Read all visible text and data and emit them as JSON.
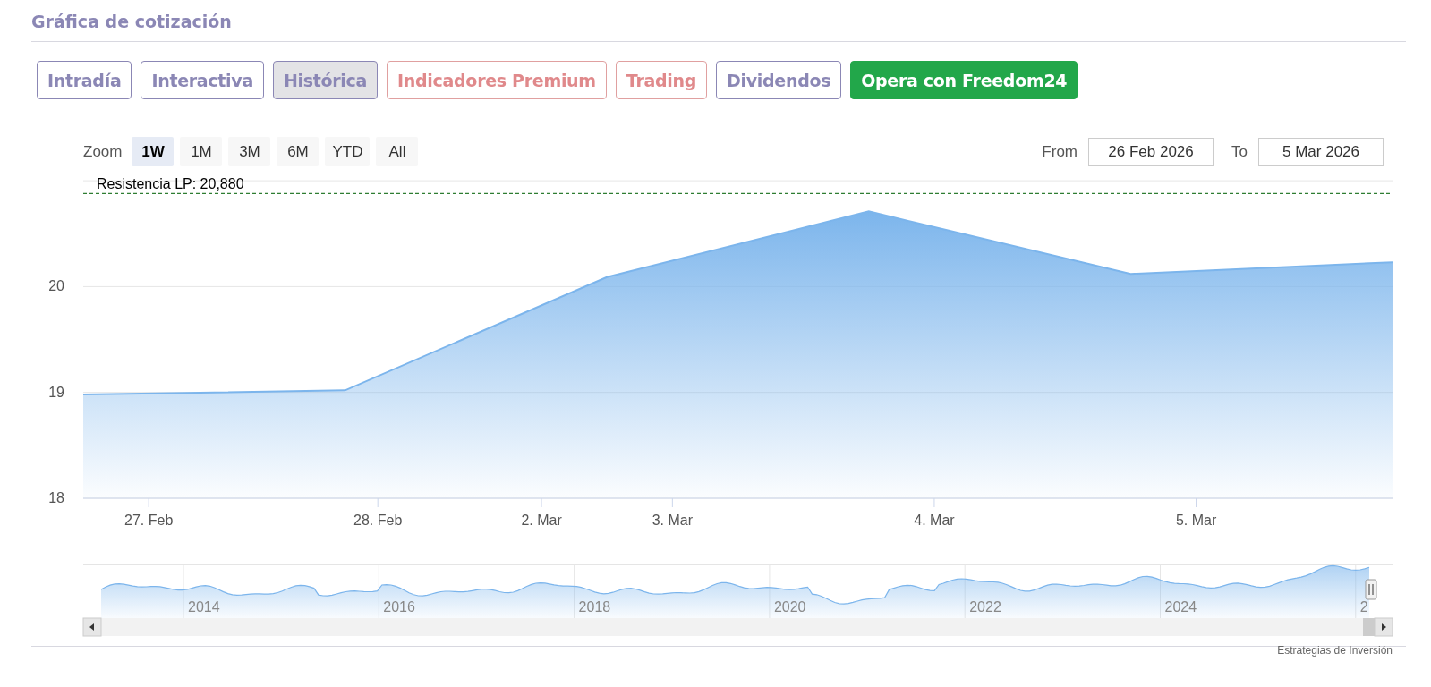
{
  "section": {
    "title": "Gráfica de cotización"
  },
  "tabs": [
    {
      "label": "Intradía",
      "kind": "standard",
      "selected": false
    },
    {
      "label": "Interactiva",
      "kind": "standard",
      "selected": false
    },
    {
      "label": "Histórica",
      "kind": "standard",
      "selected": true
    },
    {
      "label": "Indicadores Premium",
      "kind": "premium",
      "selected": false
    },
    {
      "label": "Trading",
      "kind": "premium",
      "selected": false
    },
    {
      "label": "Dividendos",
      "kind": "standard",
      "selected": false
    },
    {
      "label": "Opera con Freedom24",
      "kind": "cta",
      "selected": false
    }
  ],
  "range_selector": {
    "label": "Zoom",
    "buttons": [
      {
        "label": "1W",
        "selected": true
      },
      {
        "label": "1M",
        "selected": false
      },
      {
        "label": "3M",
        "selected": false
      },
      {
        "label": "6M",
        "selected": false
      },
      {
        "label": "YTD",
        "selected": false
      },
      {
        "label": "All",
        "selected": false
      }
    ],
    "from_label": "From",
    "from_value": "26 Feb 2026",
    "to_label": "To",
    "to_value": "5 Mar 2026"
  },
  "chart": {
    "chart_data": {
      "type": "area",
      "categories": [
        null,
        null,
        "27. Feb",
        null,
        null,
        null,
        null,
        null,
        null,
        "28. Feb",
        null,
        null,
        null,
        null,
        "2. Mar",
        null,
        null,
        null,
        "3. Mar",
        null,
        null,
        null,
        null,
        null,
        null,
        null,
        "4. Mar",
        null,
        null,
        null,
        null,
        null,
        null,
        null,
        "5. Mar",
        null,
        null,
        null,
        null,
        null,
        null
      ],
      "series": [
        {
          "color": "#7cb5ec",
          "values": [
            18.98,
            null,
            null,
            null,
            null,
            null,
            null,
            null,
            19.02,
            null,
            null,
            null,
            null,
            null,
            null,
            null,
            20.09,
            null,
            null,
            null,
            null,
            null,
            null,
            null,
            20.71,
            null,
            null,
            null,
            null,
            null,
            null,
            null,
            20.12,
            null,
            null,
            null,
            null,
            null,
            null,
            null,
            20.23
          ]
        }
      ],
      "ylim": [
        18,
        21
      ],
      "yticks": [
        18,
        19,
        20
      ],
      "ref_lines": [
        {
          "axis": "y",
          "value": 20.88,
          "label": "Resistencia LP: 20,880"
        }
      ]
    }
  },
  "navigator": {
    "year_labels": [
      "2014",
      "2016",
      "2018",
      "2020",
      "2022",
      "2024",
      "2"
    ]
  },
  "credit": "Estrategias de Inversión"
}
